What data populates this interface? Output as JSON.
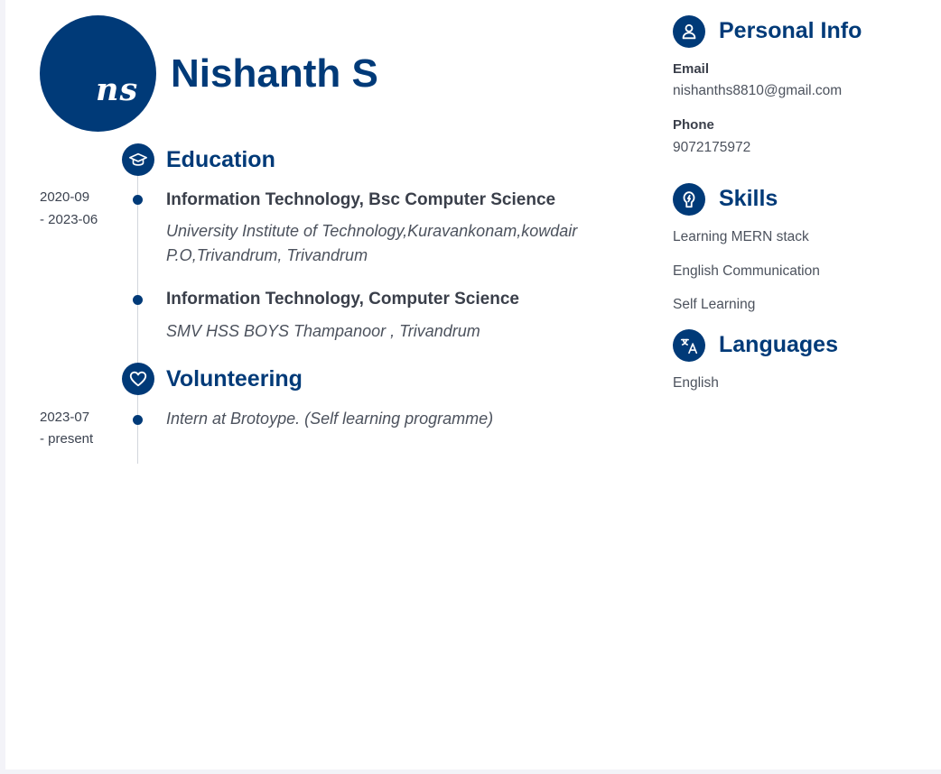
{
  "header": {
    "initials": "ns",
    "name": "Nishanth S"
  },
  "education": {
    "title": "Education",
    "entries": [
      {
        "date_start": "2020-09",
        "date_end": "- 2023-06",
        "title": "Information Technology, Bsc Computer Science",
        "sub_line1": "University Institute of Technology,Kuravankonam,kowdair",
        "sub_line2": "P.O,Trivandrum, Trivandrum"
      },
      {
        "title": "Information Technology, Computer Science",
        "sub_line1": "SMV HSS BOYS Thampanoor , Trivandrum"
      }
    ]
  },
  "volunteering": {
    "title": "Volunteering",
    "entries": [
      {
        "date_start": "2023-07",
        "date_end": "- present",
        "sub_line1": "Intern at Brotoype. (Self learning programme)"
      }
    ]
  },
  "personal": {
    "title": "Personal Info",
    "email_label": "Email",
    "email": "nishanths8810@gmail.com",
    "phone_label": "Phone",
    "phone": "9072175972"
  },
  "skills": {
    "title": "Skills",
    "items": [
      "Learning MERN stack",
      "English Communication",
      "Self Learning"
    ]
  },
  "languages": {
    "title": "Languages",
    "items": [
      "English"
    ]
  },
  "colors": {
    "accent": "#003a78",
    "text": "#3c4350",
    "background": "#ffffff"
  },
  "icons": {
    "education": "graduation-cap-icon",
    "volunteering": "heart-icon",
    "personal": "user-icon",
    "skills": "lightbulb-icon",
    "languages": "translate-icon"
  }
}
